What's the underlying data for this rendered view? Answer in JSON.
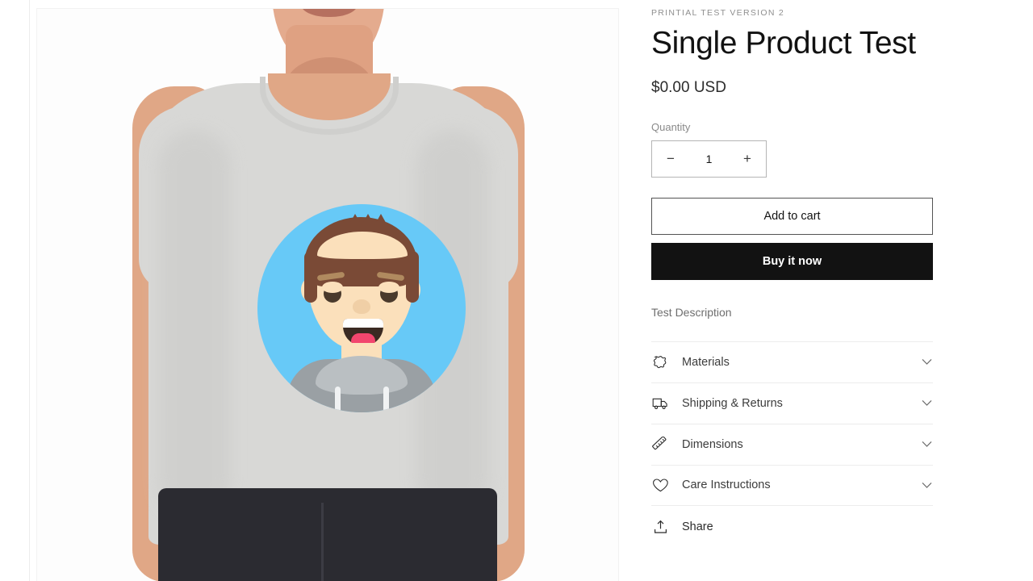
{
  "product": {
    "vendor": "PRINTIAL TEST VERSION 2",
    "title": "Single Product Test",
    "price": "$0.00 USD",
    "description": "Test Description"
  },
  "quantity": {
    "label": "Quantity",
    "value": "1",
    "decrease_label": "−",
    "increase_label": "+"
  },
  "actions": {
    "add_to_cart": "Add to cart",
    "buy_it_now": "Buy it now"
  },
  "accordion": [
    {
      "label": "Materials",
      "icon": "leather-hide-icon"
    },
    {
      "label": "Shipping & Returns",
      "icon": "truck-icon"
    },
    {
      "label": "Dimensions",
      "icon": "ruler-icon"
    },
    {
      "label": "Care Instructions",
      "icon": "heart-icon"
    }
  ],
  "share": {
    "label": "Share",
    "icon": "share-icon"
  },
  "gallery": {
    "alt": "Model wearing light gray t-shirt with cartoon avatar print"
  },
  "colors": {
    "buy_button_background": "#121212",
    "text_primary": "#121212",
    "text_muted": "#8a8a8a",
    "border": "#ececec",
    "avatar_circle": "#67c9f7",
    "avatar_hair": "#7a4a36",
    "avatar_skin": "#fbe0bb",
    "avatar_hoodie": "#9aa0a4",
    "shirt": "#d8d8d6",
    "jeans": "#2b2b31"
  }
}
